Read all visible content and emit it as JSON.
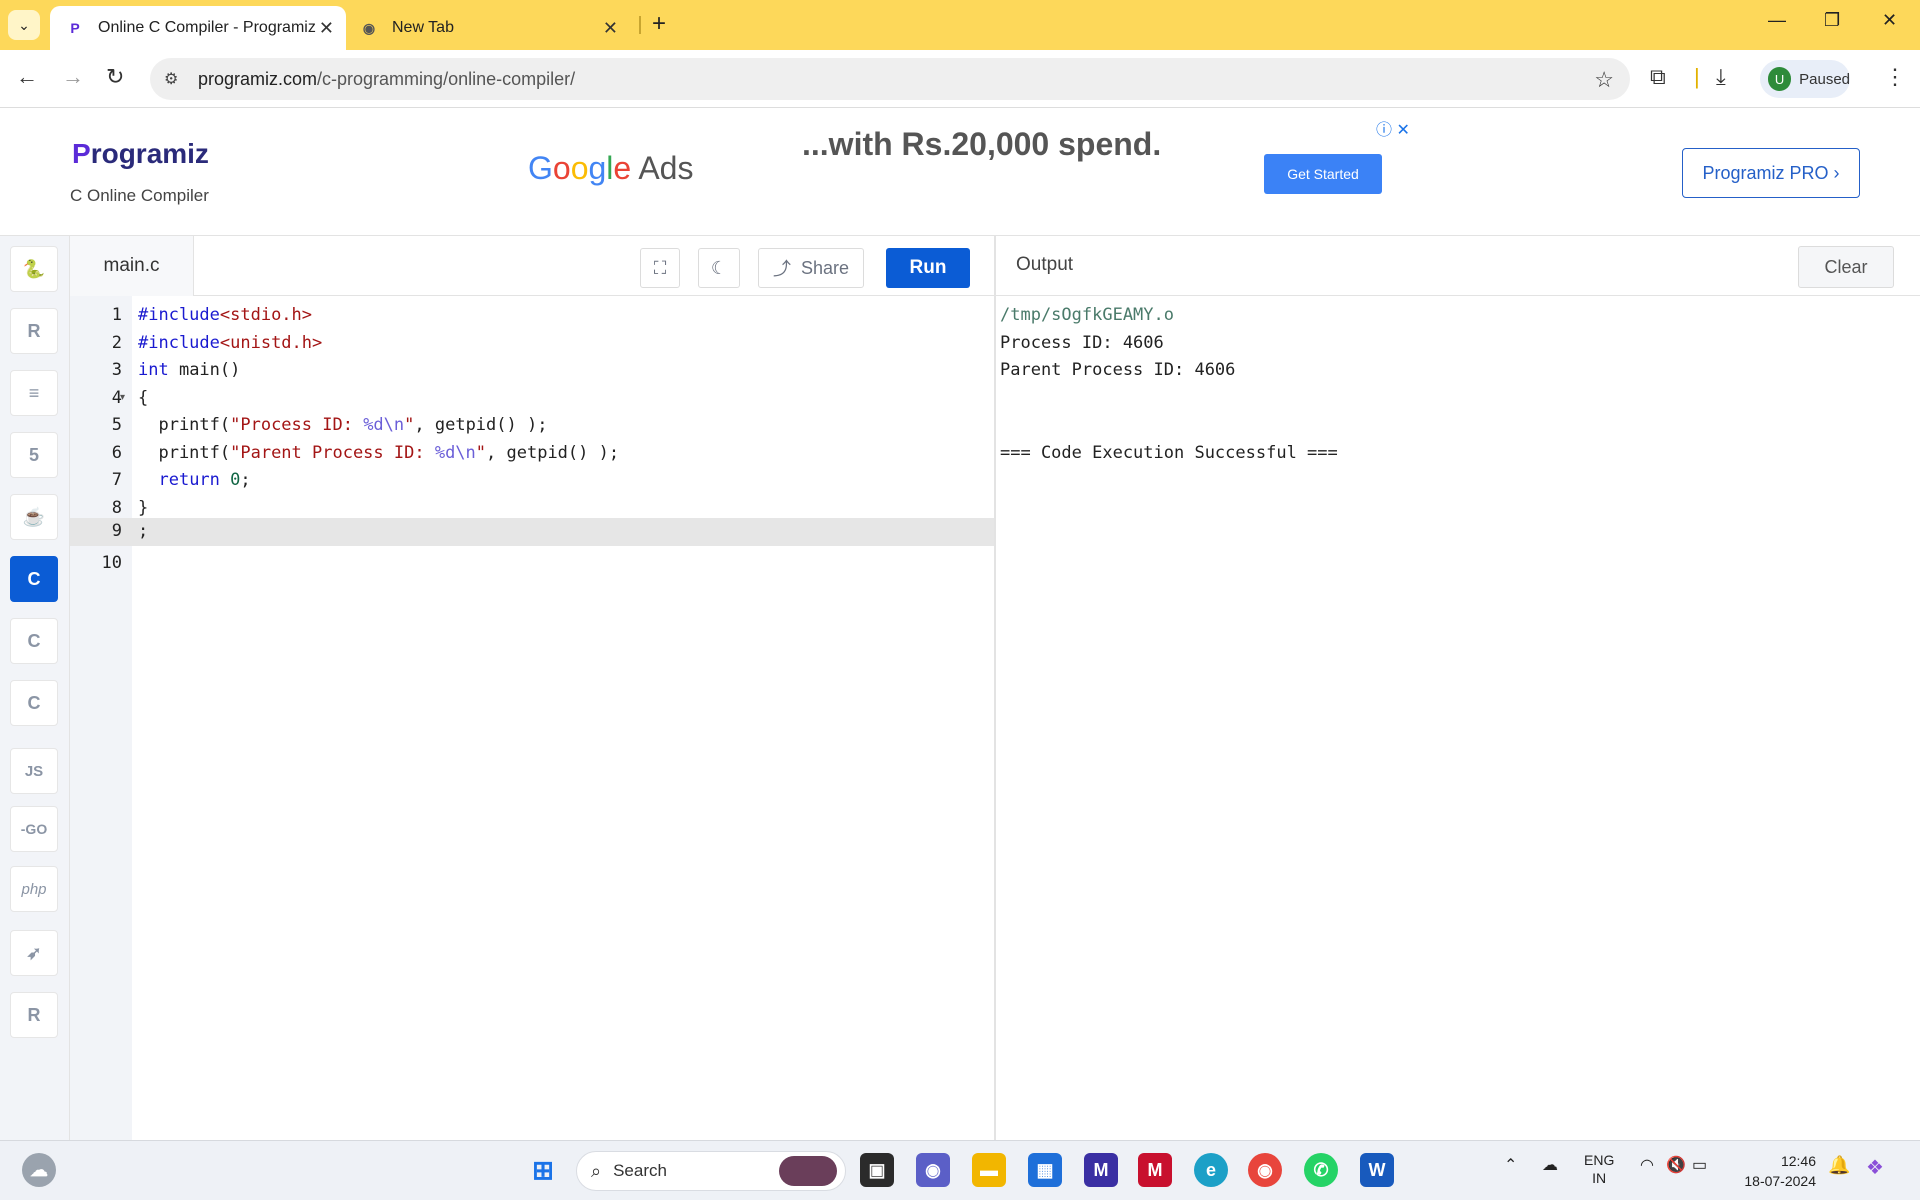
{
  "browser": {
    "tabs": [
      {
        "title": "Online C Compiler - Programiz",
        "active": true
      },
      {
        "title": "New Tab",
        "active": false
      }
    ],
    "url_host": "programiz.com",
    "url_path": "/c-programming/online-compiler/",
    "profile_initial": "U",
    "profile_status": "Paused"
  },
  "header": {
    "logo_text": "rogramiz",
    "logo_p": "P",
    "subtitle": "C Online Compiler",
    "ad_brand": "Ads",
    "ad_text": "...with Rs.20,000 spend.",
    "ad_button": "Get Started",
    "pro_button": "Programiz PRO ›"
  },
  "languages": [
    {
      "name": "python",
      "label": "🐍"
    },
    {
      "name": "r",
      "label": "R"
    },
    {
      "name": "sql",
      "label": "≡"
    },
    {
      "name": "html",
      "label": "5"
    },
    {
      "name": "java",
      "label": "☕"
    },
    {
      "name": "c",
      "label": "C",
      "active": true
    },
    {
      "name": "cpp",
      "label": "C"
    },
    {
      "name": "csharp",
      "label": "C"
    },
    {
      "name": "js",
      "label": "JS"
    },
    {
      "name": "go",
      "label": "-GO"
    },
    {
      "name": "php",
      "label": "php"
    },
    {
      "name": "swift",
      "label": "➶"
    },
    {
      "name": "rust",
      "label": "R"
    }
  ],
  "editor": {
    "filename": "main.c",
    "share_label": "Share",
    "run_label": "Run",
    "line_numbers": [
      "1",
      "2",
      "3",
      "4",
      "5",
      "6",
      "7",
      "8",
      "9",
      "10"
    ],
    "code_lines": [
      "#include<stdio.h>",
      "#include<unistd.h>",
      "int main()",
      "{",
      "  printf(\"Process ID: %d\\n\", getpid() );",
      "  printf(\"Parent Process ID: %d\\n\", getpid() );",
      "  return 0;",
      "}",
      ";",
      ""
    ],
    "highlighted_line": 9
  },
  "output": {
    "title": "Output",
    "clear_label": "Clear",
    "lines": [
      "/tmp/sOgfkGEAMY.o",
      "Process ID: 4606",
      "Parent Process ID: 4606",
      "",
      "",
      "=== Code Execution Successful ==="
    ]
  },
  "taskbar": {
    "search_placeholder": "Search",
    "lang_top": "ENG",
    "lang_bottom": "IN",
    "time": "12:46",
    "date": "18-07-2024"
  }
}
